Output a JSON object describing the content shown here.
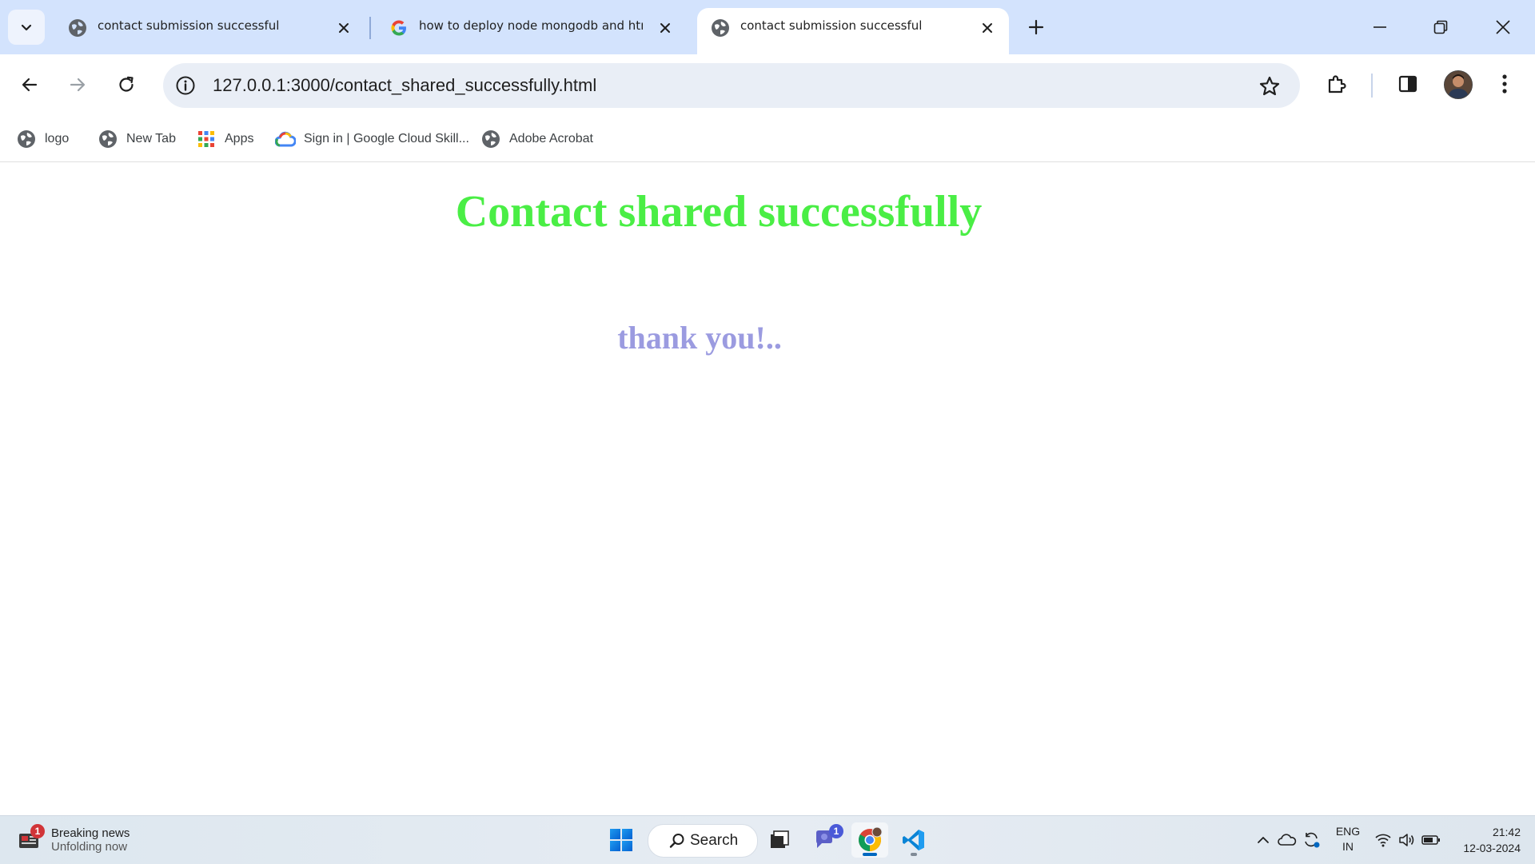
{
  "browser": {
    "tabs": [
      {
        "title": "contact submission successful",
        "favicon": "globe-icon",
        "active": false
      },
      {
        "title": "how to deploy node mongodb and html,c",
        "favicon": "google-icon",
        "active": false
      },
      {
        "title": "contact submission successful",
        "favicon": "globe-icon",
        "active": true
      }
    ],
    "url": "127.0.0.1:3000/contact_shared_successfully.html",
    "bookmarks": [
      {
        "label": "logo",
        "icon": "globe-icon"
      },
      {
        "label": "New Tab",
        "icon": "globe-icon"
      },
      {
        "label": "Apps",
        "icon": "apps-grid-icon"
      },
      {
        "label": "Sign in | Google Cloud Skill...",
        "icon": "google-cloud-icon"
      },
      {
        "label": "Adobe Acrobat",
        "icon": "globe-icon"
      }
    ]
  },
  "page": {
    "heading": "Contact shared successfully",
    "subheading": "thank you!..",
    "heading_color": "#4aee45",
    "subheading_color": "#9b9be0"
  },
  "taskbar": {
    "news": {
      "title": "Breaking news",
      "subtitle": "Unfolding now",
      "badge": "1"
    },
    "search_label": "Search",
    "teams_badge": "1",
    "language": {
      "line1": "ENG",
      "line2": "IN"
    },
    "clock": {
      "time": "21:42",
      "date": "12-03-2024"
    }
  }
}
